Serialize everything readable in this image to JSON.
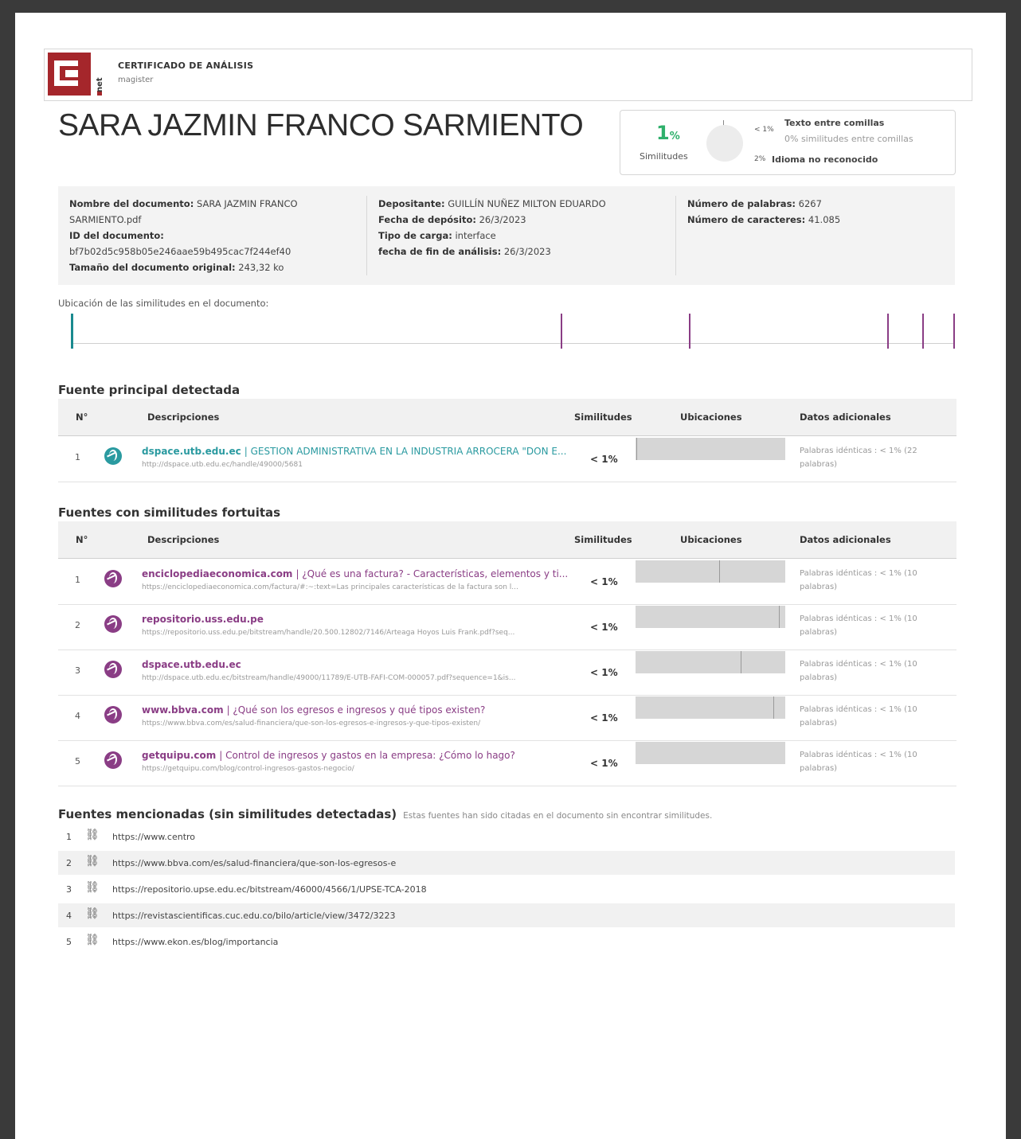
{
  "header": {
    "cert_title": "CERTIFICADO DE ANÁLISIS",
    "cert_sub": "magister",
    "logo_text": "net"
  },
  "author": "SARA JAZMIN FRANCO SARMIENTO",
  "similarity": {
    "percent": "1",
    "percent_sign": "%",
    "label": "Similitudes",
    "legend": [
      {
        "value": "< 1%",
        "label": "Texto entre comillas"
      },
      {
        "value": "",
        "label": "0% similitudes entre comillas"
      },
      {
        "value": "2%",
        "label": "Idioma no reconocido"
      }
    ]
  },
  "meta": {
    "doc_name_label": "Nombre del documento:",
    "doc_name": "SARA JAZMIN FRANCO SARMIENTO.pdf",
    "doc_id_label": "ID del documento:",
    "doc_id": "bf7b02d5c958b05e246aae59b495cac7f244ef40",
    "size_label": "Tamaño del documento original:",
    "size": "243,32 ko",
    "depositor_label": "Depositante:",
    "depositor": "GUILLÍN NUÑEZ MILTON EDUARDO",
    "deposit_date_label": "Fecha de depósito:",
    "deposit_date": "26/3/2023",
    "upload_type_label": "Tipo de carga:",
    "upload_type": "interface",
    "end_date_label": "fecha de fin de análisis:",
    "end_date": "26/3/2023",
    "words_label": "Número de palabras:",
    "words": "6267",
    "chars_label": "Número de caracteres:",
    "chars": "41.085"
  },
  "location_label": "Ubicación de las similitudes en el documento:",
  "location_ticks": [
    {
      "pos": 0.0,
      "color": "#1a8a8f",
      "width": 3
    },
    {
      "pos": 0.555,
      "color": "#8a3d85",
      "width": 2
    },
    {
      "pos": 0.7,
      "color": "#8a3d85",
      "width": 2
    },
    {
      "pos": 0.925,
      "color": "#8a3d85",
      "width": 2
    },
    {
      "pos": 0.965,
      "color": "#8a3d85",
      "width": 2
    },
    {
      "pos": 1.0,
      "color": "#8a3d85",
      "width": 2
    }
  ],
  "columns": {
    "num": "N°",
    "desc": "Descripciones",
    "sim": "Similitudes",
    "loc": "Ubicaciones",
    "extra": "Datos adicionales"
  },
  "main_source": {
    "title": "Fuente principal detectada",
    "rows": [
      {
        "num": "1",
        "domain": "dspace.utb.edu.ec",
        "desc": "| GESTION ADMINISTRATIVA EN LA INDUSTRIA ARROCERA \"DON E...",
        "url": "http://dspace.utb.edu.ec/handle/49000/5681",
        "sim": "< 1%",
        "marks": [
          0.005
        ],
        "extra1": "Palabras idénticas : < 1% (22",
        "extra2": "palabras)"
      }
    ]
  },
  "fortuitous": {
    "title": "Fuentes con similitudes fortuitas",
    "rows": [
      {
        "num": "1",
        "domain": "enciclopediaeconomica.com",
        "desc": "| ¿Qué es una factura? - Características, elementos y ti...",
        "url": "https://enciclopediaeconomica.com/factura/#:~:text=Las principales características de la factura son l...",
        "sim": "< 1%",
        "marks": [
          0.56
        ],
        "extra1": "Palabras idénticas : < 1% (10",
        "extra2": "palabras)"
      },
      {
        "num": "2",
        "domain": "repositorio.uss.edu.pe",
        "desc": "",
        "url": "https://repositorio.uss.edu.pe/bitstream/handle/20.500.12802/7146/Arteaga Hoyos Luis Frank.pdf?seq...",
        "sim": "< 1%",
        "marks": [
          0.96
        ],
        "extra1": "Palabras idénticas : < 1% (10",
        "extra2": "palabras)"
      },
      {
        "num": "3",
        "domain": "dspace.utb.edu.ec",
        "desc": "",
        "url": "http://dspace.utb.edu.ec/bitstream/handle/49000/11789/E-UTB-FAFI-COM-000057.pdf?sequence=1&is...",
        "sim": "< 1%",
        "marks": [
          0.7
        ],
        "extra1": "Palabras idénticas : < 1% (10",
        "extra2": "palabras)"
      },
      {
        "num": "4",
        "domain": "www.bbva.com",
        "desc": "| ¿Qué son los egresos e ingresos y qué tipos existen?",
        "url": "https://www.bbva.com/es/salud-financiera/que-son-los-egresos-e-ingresos-y-que-tipos-existen/",
        "sim": "< 1%",
        "marks": [
          0.92
        ],
        "extra1": "Palabras idénticas : < 1% (10",
        "extra2": "palabras)"
      },
      {
        "num": "5",
        "domain": "getquipu.com",
        "desc": "| Control de ingresos y gastos en la empresa: ¿Cómo lo hago?",
        "url": "https://getquipu.com/blog/control-ingresos-gastos-negocio/",
        "sim": "< 1%",
        "marks": [],
        "extra1": "Palabras idénticas : < 1% (10",
        "extra2": "palabras)"
      }
    ]
  },
  "mentioned": {
    "title": "Fuentes mencionadas (sin similitudes detectadas)",
    "note": "Estas fuentes han sido citadas en el documento sin encontrar similitudes.",
    "items": [
      {
        "num": "1",
        "url": "https://www.centro"
      },
      {
        "num": "2",
        "url": "https://www.bbva.com/es/salud-financiera/que-son-los-egresos-e"
      },
      {
        "num": "3",
        "url": "https://repositorio.upse.edu.ec/bitstream/46000/4566/1/UPSE-TCA-2018"
      },
      {
        "num": "4",
        "url": "https://revistascientificas.cuc.edu.co/bilo/article/view/3472/3223"
      },
      {
        "num": "5",
        "url": "https://www.ekon.es/blog/importancia"
      }
    ]
  },
  "colors": {
    "main_accent": "#2a9aa0",
    "fortuitous_accent": "#8a3d85",
    "similarity_green": "#2fb06b",
    "logo_red": "#a5262b"
  }
}
